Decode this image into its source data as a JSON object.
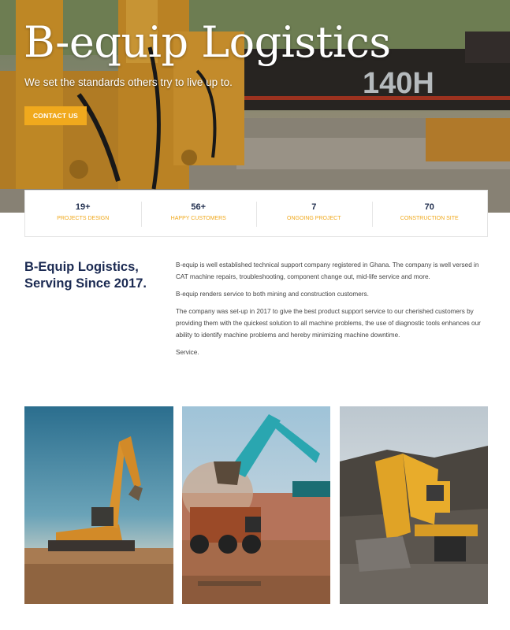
{
  "hero": {
    "title": "B-equip Logistics",
    "subtitle": "We set the standards others try to live up to.",
    "cta_label": "CONTACT US",
    "machine_label": "140H"
  },
  "stats": [
    {
      "value": "19+",
      "label": "PROJECTS DESIGN"
    },
    {
      "value": "56+",
      "label": "HAPPY CUSTOMERS"
    },
    {
      "value": "7",
      "label": "ONGOING PROJECT"
    },
    {
      "value": "70",
      "label": "CONSTRUCTION SITE"
    }
  ],
  "about": {
    "heading": "B-Equip Logistics, Serving Since 2017.",
    "paragraphs": [
      "B-equip is well established technical support company registered in Ghana. The company is well versed in CAT machine repairs, troubleshooting, component change out, mid-life service and more.",
      "B-equip renders service to both mining and construction customers.",
      "The company was set-up in 2017 to give the best product support service to our cherished customers by providing them with the quickest solution to all machine problems, the use of diagnostic tools enhances our ability to identify machine problems and hereby minimizing machine downtime.",
      "Service."
    ]
  },
  "colors": {
    "accent": "#f0a91d",
    "heading": "#1b2a52",
    "machine_yellow": "#d99a2b"
  },
  "gallery": [
    {
      "name": "excavator-sunset-image"
    },
    {
      "name": "excavator-dump-truck-image"
    },
    {
      "name": "yellow-loader-quarry-image"
    }
  ]
}
